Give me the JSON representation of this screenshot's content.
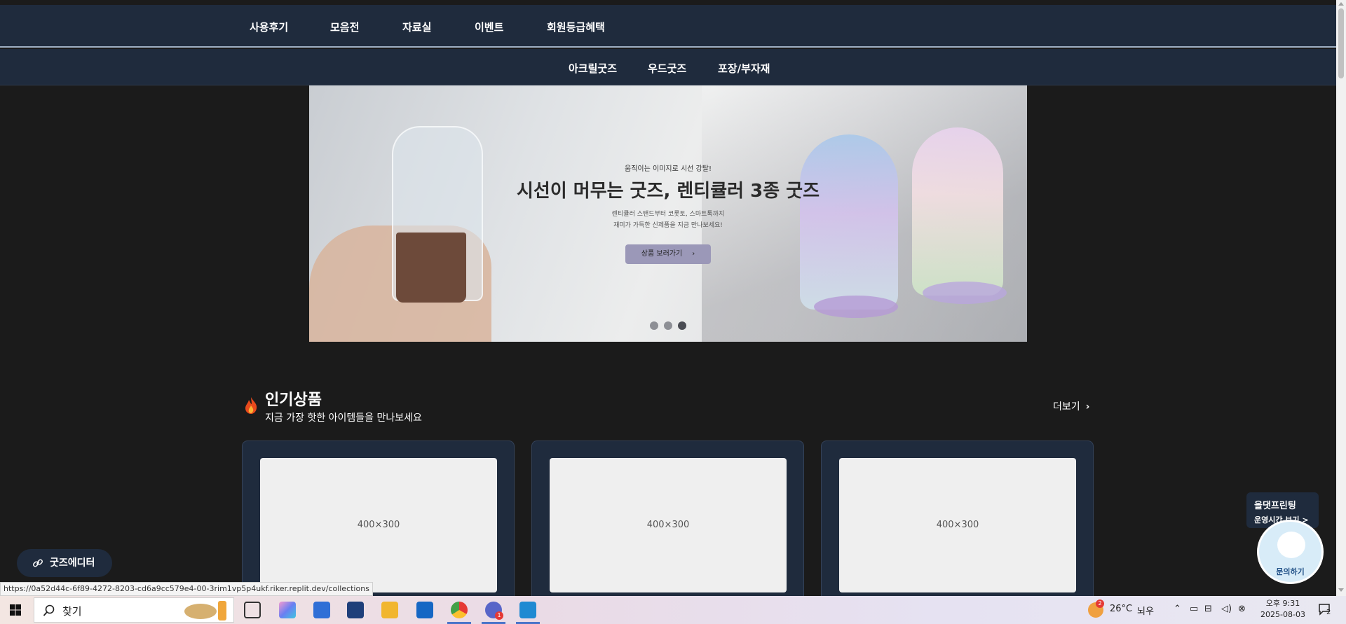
{
  "nav_primary": [
    "사용후기",
    "모음전",
    "자료실",
    "이벤트",
    "회원등급혜택"
  ],
  "nav_secondary": [
    "아크릴굿즈",
    "우드굿즈",
    "포장/부자재"
  ],
  "banner": {
    "subtitle": "움직이는 이미지로 시선 강탈!",
    "title": "시선이 머무는 굿즈, 렌티큘러 3종 굿즈",
    "desc_line1": "렌티큘러 스탠드부터 코롯토, 스마트톡까지",
    "desc_line2": "재미가 가득한 신제품을 지금 만나보세요!",
    "button": "상품 보러가기",
    "slides": 3,
    "active_slide": 3
  },
  "popular": {
    "title": "인기상품",
    "subtitle": "지금 가장 핫한 아이템들을 만나보세요",
    "more": "더보기",
    "cards": [
      {
        "placeholder": "400×300"
      },
      {
        "placeholder": "400×300"
      },
      {
        "placeholder": "400×300"
      }
    ]
  },
  "floating": {
    "goods_editor": "굿즈에디터",
    "status_url": "https://0a52d44c-6f89-4272-8203-cd6a9cc579e4-00-3rim1vp5p4ukf.riker.replit.dev/collections",
    "chat_title": "올댓프린팅",
    "chat_hours": "운영시간 보기 >",
    "chat_button": "문의하기"
  },
  "taskbar": {
    "search_text": "찾기",
    "weather_temp": "26°C",
    "weather_desc": "뇌우",
    "weather_badge": "2",
    "time": "오후 9:31",
    "date": "2025-08-03",
    "notification_count": "2",
    "chat_app_badge": "1"
  },
  "colors": {
    "nav_bg": "#1f2b3d",
    "page_bg": "#1b1b1b",
    "banner_button": "#9b98b8",
    "card_bg": "#1f2b3d"
  }
}
